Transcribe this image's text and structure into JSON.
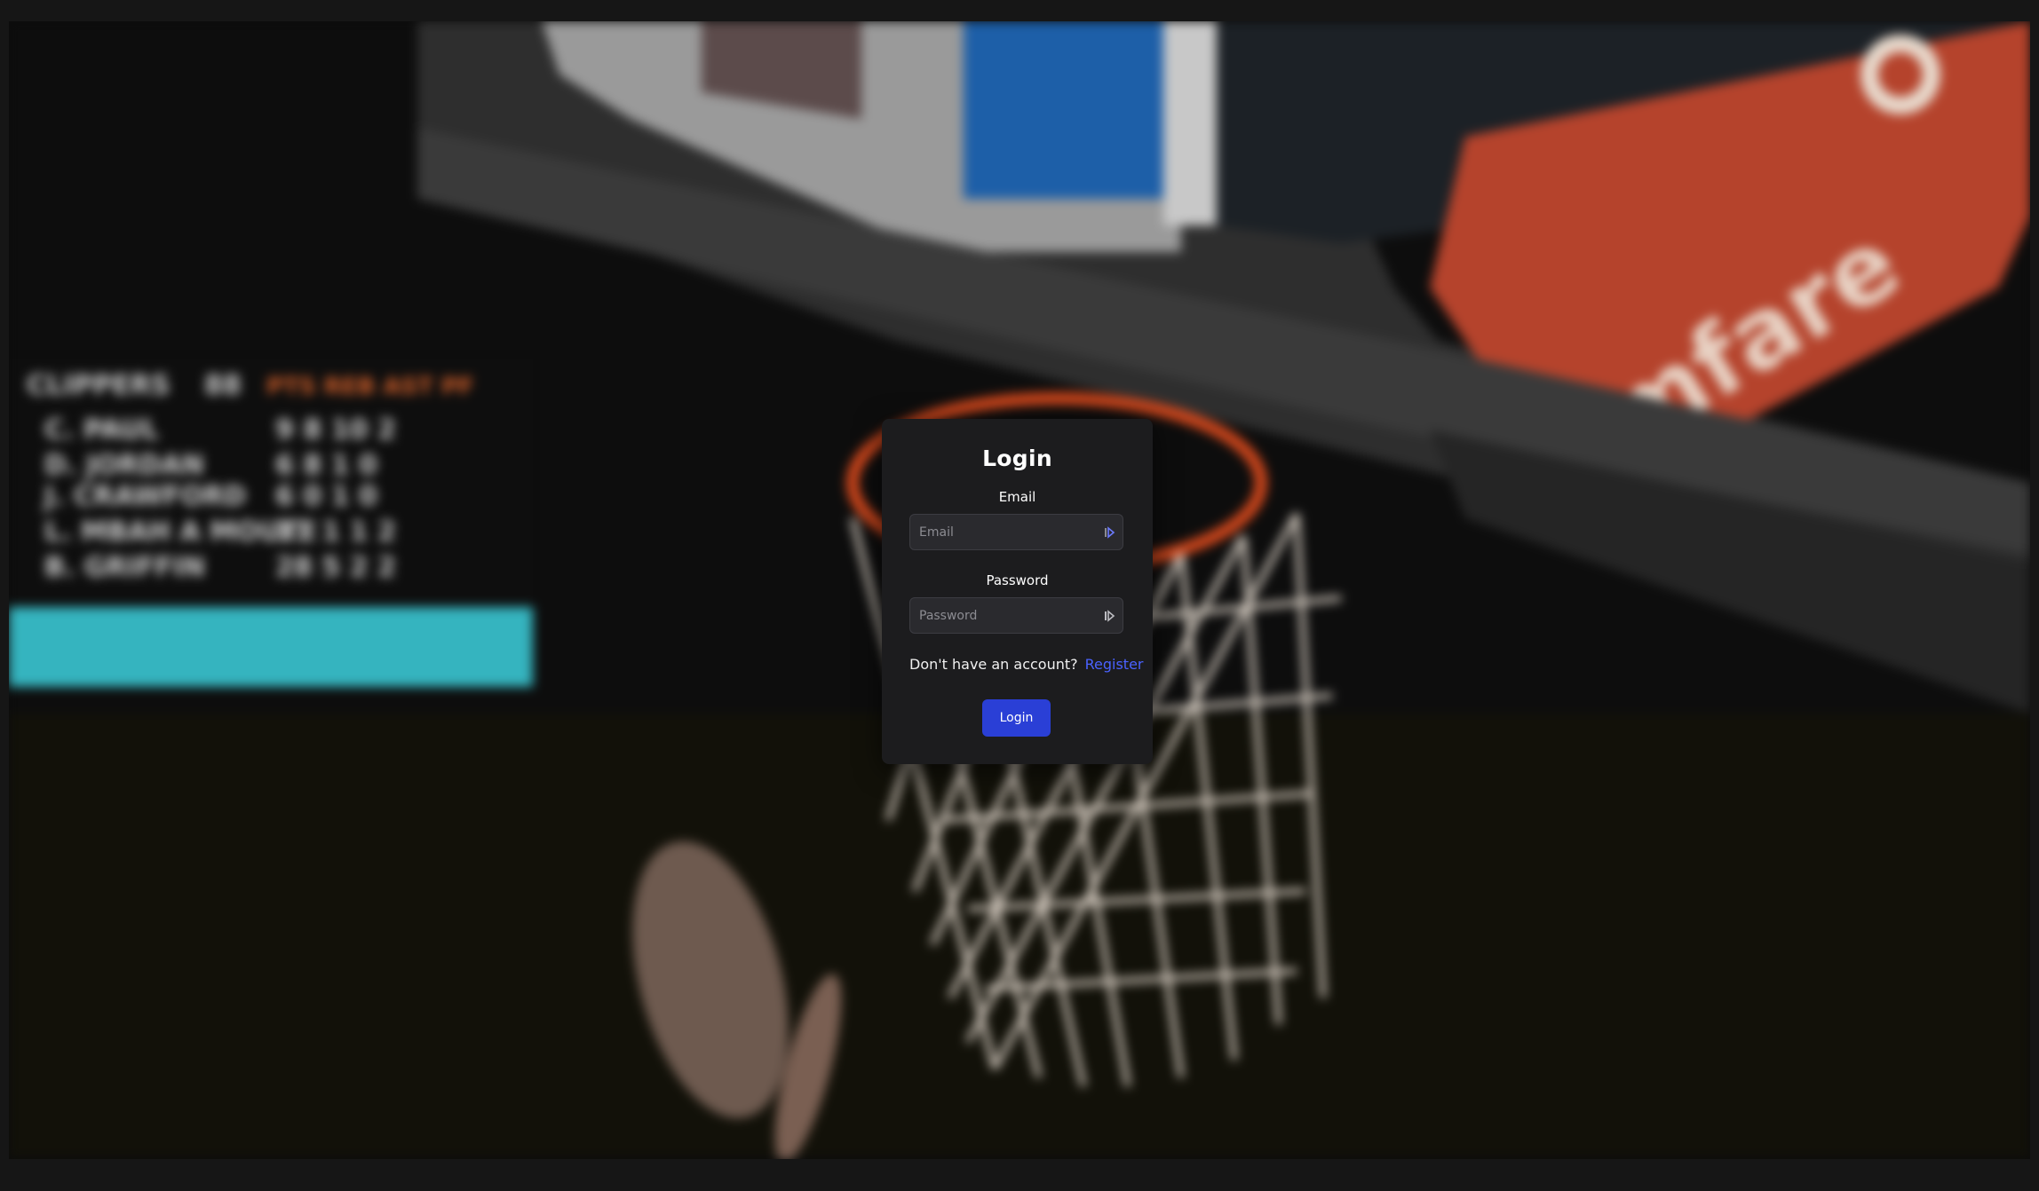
{
  "background": {
    "description_icon": "basketball-hoop-photo",
    "colors": {
      "backboard_pad": "#b5432c",
      "rim": "#d2471c",
      "net": "#e9dfd3",
      "scoreboard_bar": "#35b4bf",
      "scoreboard_text_accent": "#d4602a"
    }
  },
  "login_form": {
    "title": "Login",
    "email": {
      "label": "Email",
      "placeholder": "Email",
      "value": "",
      "icon": "autofill-key-icon"
    },
    "password": {
      "label": "Password",
      "placeholder": "Password",
      "value": "",
      "icon": "autofill-key-icon"
    },
    "register_prompt": "Don't have an account?",
    "register_link": "Register",
    "submit_label": "Login",
    "colors": {
      "card_bg": "#1c1c1e",
      "button_bg": "#2a3fd6",
      "link": "#4a62ff"
    }
  }
}
